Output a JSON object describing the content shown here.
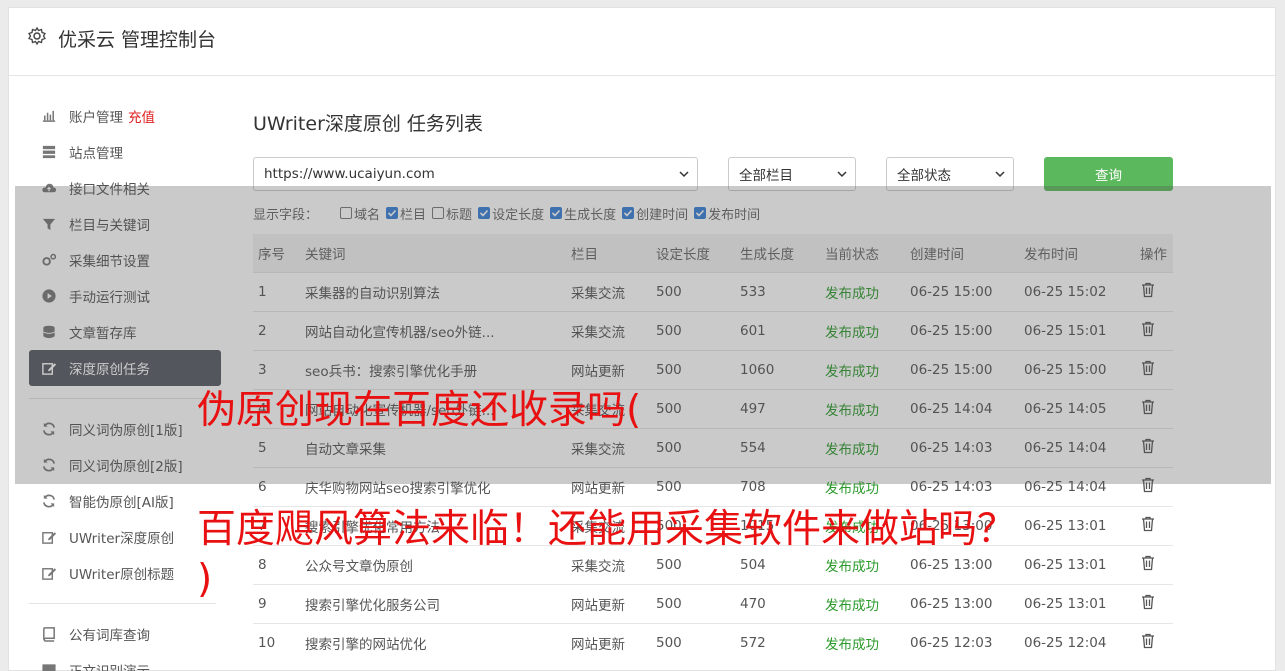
{
  "header": {
    "title": "优采云 管理控制台"
  },
  "sidebar": {
    "group1": [
      {
        "label": "账户管理",
        "badge": "充值",
        "icon": "bar-chart-icon"
      },
      {
        "label": "站点管理",
        "icon": "server-icon"
      },
      {
        "label": "接口文件相关",
        "icon": "cloud-upload-icon"
      },
      {
        "label": "栏目与关键词",
        "icon": "filter-icon"
      },
      {
        "label": "采集细节设置",
        "icon": "cogs-icon"
      },
      {
        "label": "手动运行测试",
        "icon": "play-circle-icon"
      },
      {
        "label": "文章暂存库",
        "icon": "database-icon"
      },
      {
        "label": "深度原创任务",
        "icon": "edit-icon"
      }
    ],
    "group2": [
      {
        "label": "同义词伪原创[1版]",
        "icon": "refresh-icon"
      },
      {
        "label": "同义词伪原创[2版]",
        "icon": "refresh-icon"
      },
      {
        "label": "智能伪原创[AI版]",
        "icon": "refresh-icon"
      },
      {
        "label": "UWriter深度原创",
        "icon": "edit-icon"
      },
      {
        "label": "UWriter原创标题",
        "icon": "edit-icon"
      }
    ],
    "group3": [
      {
        "label": "公有词库查询",
        "icon": "book-icon"
      },
      {
        "label": "正文识别演示",
        "icon": "monitor-icon"
      }
    ]
  },
  "main": {
    "title": "UWriter深度原创 任务列表",
    "site_select": "https://www.ucaiyun.com",
    "column_select": "全部栏目",
    "status_select": "全部状态",
    "query_button": "查询",
    "fields_label": "显示字段：",
    "fields": [
      {
        "label": "域名",
        "checked": false
      },
      {
        "label": "栏目",
        "checked": true
      },
      {
        "label": "标题",
        "checked": false
      },
      {
        "label": "设定长度",
        "checked": true
      },
      {
        "label": "生成长度",
        "checked": true
      },
      {
        "label": "创建时间",
        "checked": true
      },
      {
        "label": "发布时间",
        "checked": true
      }
    ]
  },
  "table": {
    "headers": [
      "序号",
      "关键词",
      "栏目",
      "设定长度",
      "生成长度",
      "当前状态",
      "创建时间",
      "发布时间",
      "操作"
    ],
    "rows": [
      [
        "1",
        "采集器的自动识别算法",
        "采集交流",
        "500",
        "533",
        "发布成功",
        "06-25 15:00",
        "06-25 15:02"
      ],
      [
        "2",
        "网站自动化宣传机器/seo外链...",
        "采集交流",
        "500",
        "601",
        "发布成功",
        "06-25 15:00",
        "06-25 15:01"
      ],
      [
        "3",
        "seo兵书：搜索引擎优化手册",
        "网站更新",
        "500",
        "1060",
        "发布成功",
        "06-25 15:00",
        "06-25 15:00"
      ],
      [
        "4",
        "网站自动化宣传机器/seo外链...",
        "采集交流",
        "500",
        "497",
        "发布成功",
        "06-25 14:04",
        "06-25 14:05"
      ],
      [
        "5",
        "自动文章采集",
        "采集交流",
        "500",
        "554",
        "发布成功",
        "06-25 14:03",
        "06-25 14:04"
      ],
      [
        "6",
        "庆华购物网站seo搜索引擎优化",
        "网站更新",
        "500",
        "708",
        "发布成功",
        "06-25 14:03",
        "06-25 14:04"
      ],
      [
        "7",
        "搜索引擎优化常用方法",
        "采集交流",
        "500",
        "1015",
        "发布成功",
        "06-25 13:00",
        "06-25 13:01"
      ],
      [
        "8",
        "公众号文章伪原创",
        "采集交流",
        "500",
        "504",
        "发布成功",
        "06-25 13:00",
        "06-25 13:01"
      ],
      [
        "9",
        "搜索引擎优化服务公司",
        "网站更新",
        "500",
        "470",
        "发布成功",
        "06-25 13:00",
        "06-25 13:01"
      ],
      [
        "10",
        "搜索引擎的网站优化",
        "网站更新",
        "500",
        "572",
        "发布成功",
        "06-25 12:03",
        "06-25 12:04"
      ]
    ]
  },
  "watermark": {
    "line1": "伪原创现在百度还收录吗(",
    "line2": "百度飓风算法来临！还能用采集软件来做站吗？",
    "line3": ")"
  }
}
